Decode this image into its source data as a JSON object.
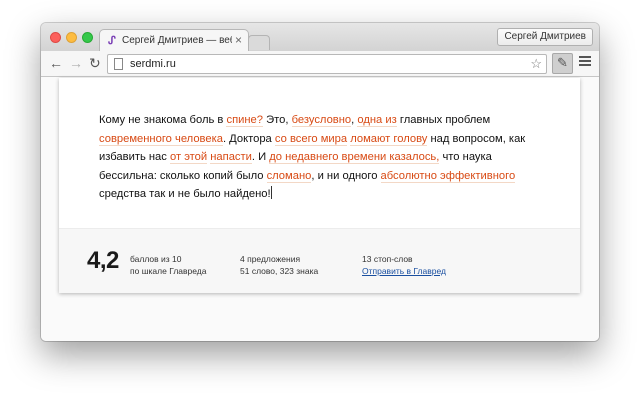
{
  "browser": {
    "tab_title": "Сергей Дмитриев — веб-",
    "tab_close": "×",
    "profile_name": "Сергей Дмитриев",
    "url": "serdmi.ru",
    "nav": {
      "back": "←",
      "forward": "→",
      "reload": "↻",
      "star": "☆"
    }
  },
  "editor": {
    "segments": [
      {
        "text": "Кому не знакома боль в ",
        "hl": false
      },
      {
        "text": "спине?",
        "hl": true
      },
      {
        "text": " Это, ",
        "hl": false
      },
      {
        "text": "безусловно",
        "hl": true
      },
      {
        "text": ", ",
        "hl": false
      },
      {
        "text": "одна из",
        "hl": true
      },
      {
        "text": " главных проблем ",
        "hl": false
      },
      {
        "text": "современного человека",
        "hl": true
      },
      {
        "text": ". Доктора ",
        "hl": false
      },
      {
        "text": "со всего мира",
        "hl": true
      },
      {
        "text": " ",
        "hl": false
      },
      {
        "text": "ломают голову",
        "hl": true
      },
      {
        "text": " над вопросом, как избавить нас ",
        "hl": false
      },
      {
        "text": "от этой",
        "hl": true
      },
      {
        "text": " ",
        "hl": false
      },
      {
        "text": "напасти",
        "hl": true
      },
      {
        "text": ". И ",
        "hl": false
      },
      {
        "text": "до недавнего времени казалось,",
        "hl": true
      },
      {
        "text": " что наука бессильна: сколько копий было ",
        "hl": false
      },
      {
        "text": "сломано",
        "hl": true
      },
      {
        "text": ", и ни одного ",
        "hl": false
      },
      {
        "text": "абсолютно эффективного",
        "hl": true
      },
      {
        "text": " средства так и не было найдено!",
        "hl": false
      }
    ]
  },
  "stats": {
    "score": "4,2",
    "score_line1": "баллов из 10",
    "score_line2": "по шкале Главреда",
    "sentences": "4 предложения",
    "words": "51 слово, 323 знака",
    "stopwords": "13 стоп-слов",
    "send_link": "Отправить в Главред"
  },
  "colors": {
    "highlight": "#d84a14",
    "link": "#1a4fa0"
  }
}
